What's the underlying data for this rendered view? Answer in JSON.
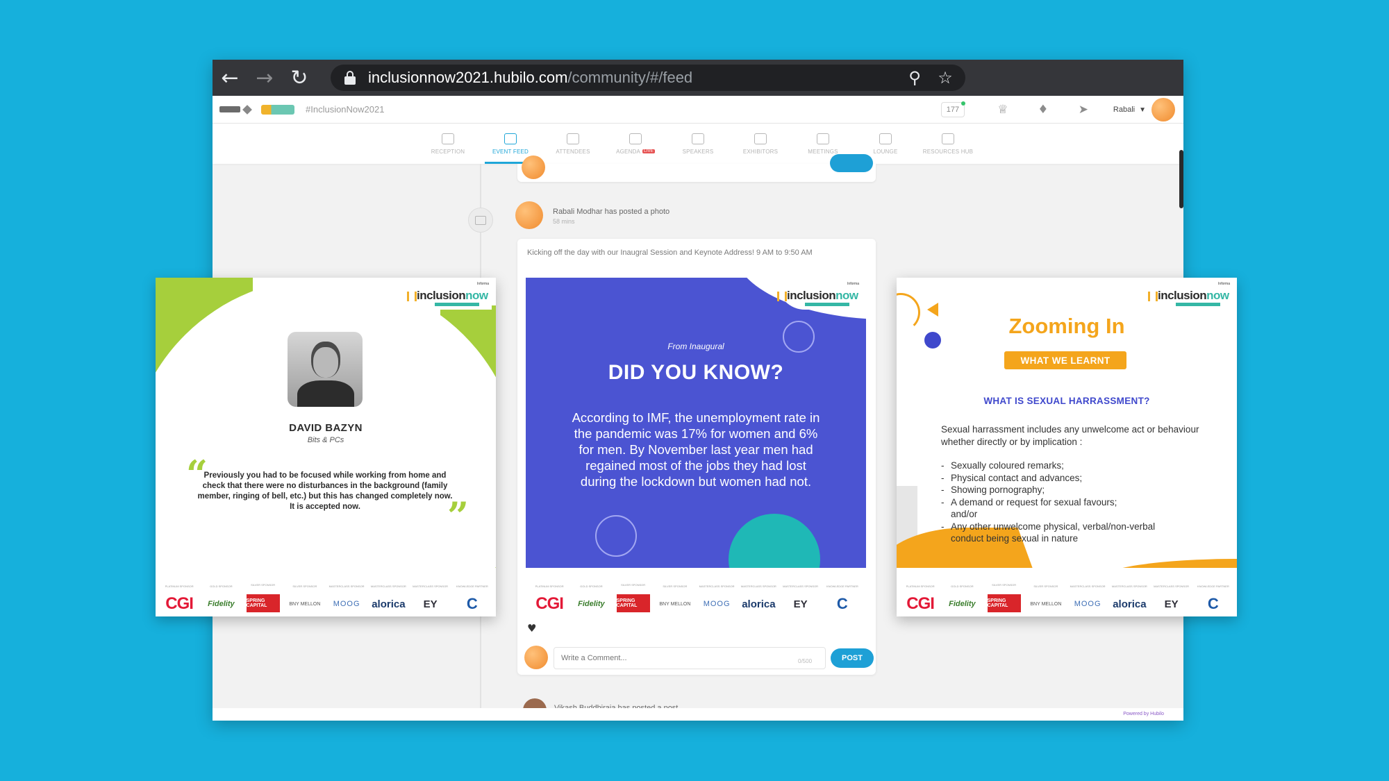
{
  "browser": {
    "url_host": "inclusionnow2021.hubilo.com",
    "url_path": "/community/#/feed"
  },
  "topbar": {
    "hashtag": "#InclusionNow2021",
    "online_count": "177",
    "user_name": "Rabali"
  },
  "nav_tabs": [
    {
      "label": "Reception",
      "icon": "reception-icon"
    },
    {
      "label": "Event Feed",
      "icon": "feed-icon",
      "active": true
    },
    {
      "label": "Attendees",
      "icon": "attendees-icon"
    },
    {
      "label": "Agenda",
      "icon": "agenda-icon",
      "badge": "LIVE"
    },
    {
      "label": "Speakers",
      "icon": "mic-icon"
    },
    {
      "label": "Exhibitors",
      "icon": "exhibitors-icon"
    },
    {
      "label": "Meetings",
      "icon": "meetings-icon"
    },
    {
      "label": "Lounge",
      "icon": "lounge-icon"
    },
    {
      "label": "Resources Hub",
      "icon": "resources-icon"
    }
  ],
  "feed": {
    "poster": "Rabali Modhar has posted a photo",
    "poster_time": "58 mins",
    "caption": "Kicking off the day with our Inaugral Session and Keynote Address! 9 AM to 9:50 AM",
    "comment_placeholder": "Write a Comment...",
    "comment_count": "0/500",
    "post_label": "POST",
    "next_poster": "Vikash Buddhiraja has posted a post"
  },
  "footer": {
    "powered_by": "Powered by Hubilo"
  },
  "brand": {
    "incl": "inclusion",
    "now": "now",
    "mini": "Informa"
  },
  "sponsors": [
    {
      "tier": "Platinum Sponsor",
      "name": "CGI",
      "cls": "cgi"
    },
    {
      "tier": "Gold Sponsor",
      "name": "Fidelity",
      "cls": "fid"
    },
    {
      "tier": "Silver Sponsor",
      "name": "SPRING CAPITAL",
      "cls": "red"
    },
    {
      "tier": "Silver Sponsor",
      "name": "BNY MELLON",
      "cls": "bny"
    },
    {
      "tier": "Masterclass Sponsor",
      "name": "MOOG",
      "cls": "moo"
    },
    {
      "tier": "Masterclass Sponsor",
      "name": "alorica",
      "cls": "alo"
    },
    {
      "tier": "Masterclass Sponsor",
      "name": "EY",
      "cls": "ey"
    },
    {
      "tier": "Knowledge Partner",
      "name": "C",
      "cls": "cat"
    }
  ],
  "left_card": {
    "speaker_name": "DAVID BAZYN",
    "company": "Bits & PCs",
    "quote": "Previously you had to be focused while working from home and check that there were no disturbances in the background (family member, ringing of bell, etc.) but this has changed completely now. It is accepted now."
  },
  "center_card": {
    "from": "From Inaugural",
    "title": "DID YOU KNOW?",
    "body": "According to IMF, the unemployment rate in the pandemic was 17% for women and 6% for men. By November last year men had regained most of the jobs they had lost during the lockdown but women had not."
  },
  "right_card": {
    "title": "Zooming In",
    "badge": "WHAT WE LEARNT",
    "question": "WHAT IS SEXUAL HARRASSMENT?",
    "intro": "Sexual harrassment includes any unwelcome act or behaviour whether directly or by implication :",
    "items": [
      "Sexually coloured remarks;",
      "Physical contact and advances;",
      "Showing pornography;",
      "A demand or request for sexual favours;",
      "and/or",
      "Any other unwelcome physical, verbal/non-verbal",
      "conduct being sexual in nature"
    ]
  }
}
